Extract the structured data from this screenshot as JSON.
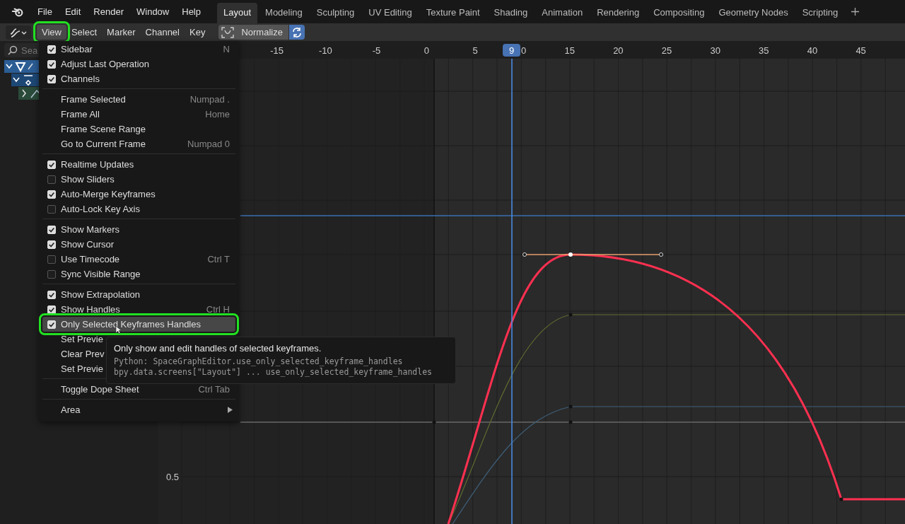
{
  "top_menus": [
    "File",
    "Edit",
    "Render",
    "Window",
    "Help"
  ],
  "workspaces": [
    {
      "label": "Layout",
      "selected": true
    },
    {
      "label": "Modeling",
      "selected": false
    },
    {
      "label": "Sculpting",
      "selected": false
    },
    {
      "label": "UV Editing",
      "selected": false
    },
    {
      "label": "Texture Paint",
      "selected": false
    },
    {
      "label": "Shading",
      "selected": false
    },
    {
      "label": "Animation",
      "selected": false
    },
    {
      "label": "Rendering",
      "selected": false
    },
    {
      "label": "Compositing",
      "selected": false
    },
    {
      "label": "Geometry Nodes",
      "selected": false
    },
    {
      "label": "Scripting",
      "selected": false
    }
  ],
  "header_menus": [
    {
      "label": "View",
      "selected": true,
      "annotated": true
    },
    {
      "label": "Select",
      "selected": false,
      "annotated": false
    },
    {
      "label": "Marker",
      "selected": false,
      "annotated": false
    },
    {
      "label": "Channel",
      "selected": false,
      "annotated": false
    },
    {
      "label": "Key",
      "selected": false,
      "annotated": false
    }
  ],
  "normalize": {
    "label": "Normalize",
    "on": false
  },
  "auto_normalize": {
    "on": true
  },
  "channels": {
    "search_placeholder": "Sea"
  },
  "ruler": {
    "labels": [
      "-15",
      "-10",
      "-5",
      "0",
      "5",
      "0",
      "15",
      "20",
      "25",
      "30",
      "35",
      "40",
      "45"
    ],
    "current_frame": "9"
  },
  "y_labels": [
    "0.5"
  ],
  "menu": {
    "sections": [
      [
        {
          "kind": "check",
          "label": "Sidebar",
          "shortcut": "N",
          "checked": true,
          "selected": false,
          "annotated": false
        },
        {
          "kind": "check",
          "label": "Adjust Last Operation",
          "checked": true,
          "selected": false,
          "annotated": false
        },
        {
          "kind": "check",
          "label": "Channels",
          "checked": true,
          "selected": false,
          "annotated": false
        }
      ],
      [
        {
          "kind": "plain",
          "label": "Frame Selected",
          "shortcut": "Numpad .",
          "selected": false,
          "annotated": false
        },
        {
          "kind": "plain",
          "label": "Frame All",
          "shortcut": "Home",
          "selected": false,
          "annotated": false
        },
        {
          "kind": "plain",
          "label": "Frame Scene Range",
          "selected": false,
          "annotated": false
        },
        {
          "kind": "plain",
          "label": "Go to Current Frame",
          "shortcut": "Numpad 0",
          "selected": false,
          "annotated": false
        }
      ],
      [
        {
          "kind": "check",
          "label": "Realtime Updates",
          "checked": true,
          "selected": false,
          "annotated": false
        },
        {
          "kind": "check",
          "label": "Show Sliders",
          "checked": false,
          "selected": false,
          "annotated": false
        },
        {
          "kind": "check",
          "label": "Auto-Merge Keyframes",
          "checked": true,
          "selected": false,
          "annotated": false
        },
        {
          "kind": "check",
          "label": "Auto-Lock Key Axis",
          "checked": false,
          "selected": false,
          "annotated": false
        }
      ],
      [
        {
          "kind": "check",
          "label": "Show Markers",
          "checked": true,
          "selected": false,
          "annotated": false
        },
        {
          "kind": "check",
          "label": "Show Cursor",
          "checked": true,
          "selected": false,
          "annotated": false
        },
        {
          "kind": "check",
          "label": "Use Timecode",
          "shortcut": "Ctrl T",
          "checked": false,
          "selected": false,
          "annotated": false
        },
        {
          "kind": "check",
          "label": "Sync Visible Range",
          "checked": false,
          "selected": false,
          "annotated": false
        }
      ],
      [
        {
          "kind": "check",
          "label": "Show Extrapolation",
          "checked": true,
          "selected": false,
          "annotated": false
        },
        {
          "kind": "check",
          "label": "Show Handles",
          "shortcut": "Ctrl H",
          "checked": true,
          "selected": false,
          "annotated": false
        },
        {
          "kind": "check",
          "label": "Only Selected Keyframes Handles",
          "checked": true,
          "selected": true,
          "annotated": true
        },
        {
          "kind": "plain",
          "label": "Set Previe",
          "selected": false,
          "annotated": false
        },
        {
          "kind": "plain",
          "label": "Clear Prev",
          "selected": false,
          "annotated": false
        },
        {
          "kind": "plain",
          "label": "Set Previe",
          "selected": false,
          "annotated": false
        }
      ],
      [
        {
          "kind": "plain",
          "label": "Toggle Dope Sheet",
          "shortcut": "Ctrl Tab",
          "selected": false,
          "annotated": false
        }
      ],
      [
        {
          "kind": "submenu",
          "label": "Area",
          "selected": false,
          "annotated": false
        }
      ]
    ]
  },
  "tooltip": {
    "description": "Only show and edit handles of selected keyframes.",
    "python": [
      "Python: SpaceGraphEditor.use_only_selected_keyframe_handles",
      "bpy.data.screens[\"Layout\"] ... use_only_selected_keyframe_handles"
    ]
  }
}
